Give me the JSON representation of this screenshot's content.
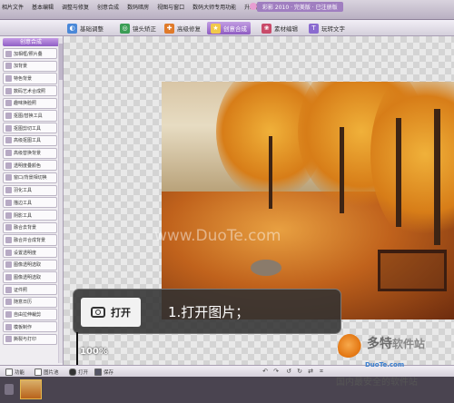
{
  "menubar": {
    "items": [
      "相片文件",
      "基本编辑",
      "调整与修复",
      "创意合成",
      "数码暗房",
      "视图与窗口",
      "数码大师专用功能",
      "升级和注册"
    ],
    "title": "彩影 2010 · 完美版 · 已注册版"
  },
  "toolbar": {
    "tabs": [
      {
        "label": "基础调整",
        "icon": "adjust-icon"
      },
      {
        "label": "镜头矫正",
        "icon": "lens-icon"
      },
      {
        "label": "高级修复",
        "icon": "repair-icon"
      },
      {
        "label": "创意合成",
        "icon": "compose-icon"
      },
      {
        "label": "素材编辑",
        "icon": "material-icon"
      },
      {
        "label": "玩转文字",
        "icon": "text-icon"
      }
    ],
    "active_tab": "创意合成"
  },
  "left_panel": {
    "header": "创意合成",
    "items": [
      "加相框/照片叠",
      "加背景",
      "特色背景",
      "数码艺术合成照",
      "趣味换脸照",
      "抠图/替换工具",
      "抠图剪切工具",
      "高级抠图工具",
      "高级替换背景",
      "透明度叠颜色",
      "窗口/背景相切换",
      "羽化工具",
      "描边工具",
      "阴影工具",
      "融合去背景",
      "融合并合成背景",
      "设置透明度",
      "图像透明选取",
      "图像透明选取",
      "证件照",
      "随意日历",
      "自由拉伸裁剪",
      "模板制作",
      "撕裂与打印"
    ]
  },
  "canvas": {
    "zoom": "100%",
    "watermark": "www.DuoTe.com"
  },
  "callout": {
    "button_label": "打开",
    "instruction": "1.打开图片；"
  },
  "bottombar": {
    "function_label": "功能",
    "picture_label": "图片池",
    "open_label": "打开",
    "save_label": "保存"
  },
  "branding": {
    "name": "多特",
    "suffix": "软件站",
    "site": "DuoTe.com",
    "slogan": "国内最安全的软件站"
  },
  "colors": {
    "accent": "#8e5bc2",
    "overlay": "#323232"
  }
}
